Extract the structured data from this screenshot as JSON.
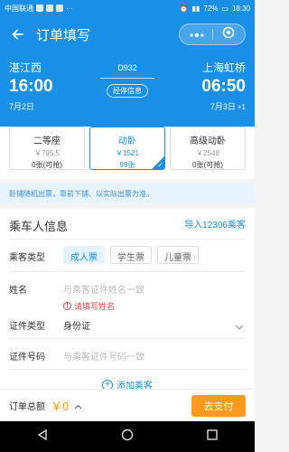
{
  "status_bar": {
    "carrier": "中国联通",
    "battery": "72%",
    "time": "18:30"
  },
  "nav": {
    "title": "订单填写"
  },
  "trip": {
    "from_station": "湛江西",
    "from_time": "16:00",
    "from_date": "7月2日",
    "train_no": "D932",
    "stops_label": "经停信息",
    "to_station": "上海虹桥",
    "to_time": "06:50",
    "to_date": "7月3日",
    "plus_day": "+1"
  },
  "seats": [
    {
      "name": "二等座",
      "price": "￥795.5",
      "avail": "0张(可抢)"
    },
    {
      "name": "动卧",
      "price": "￥1521",
      "avail": "99张"
    },
    {
      "name": "高级动卧",
      "price": "￥2548",
      "avail": "0张(可抢)"
    }
  ],
  "notice": "卧铺随机出票，靠前下铺、以实际出票为准。",
  "passenger": {
    "section_title": "乘车人信息",
    "import_label": "导入12306乘客",
    "type_label": "乘客类型",
    "types": [
      "成人票",
      "学生票",
      "儿童票"
    ],
    "name_label": "姓名",
    "name_placeholder": "与乘客证件姓名一致",
    "name_error": "请填写姓名",
    "id_type_label": "证件类型",
    "id_type_value": "身份证",
    "id_no_label": "证件号码",
    "id_no_placeholder": "与乘客证件号码一致",
    "add_label": "添加乘客"
  },
  "footer": {
    "total_label": "订单总额",
    "total_value": "￥0",
    "pay_label": "去支付"
  },
  "colors": {
    "primary": "#1a8fe8",
    "orange": "#ff9a1e",
    "error": "#e64340"
  }
}
